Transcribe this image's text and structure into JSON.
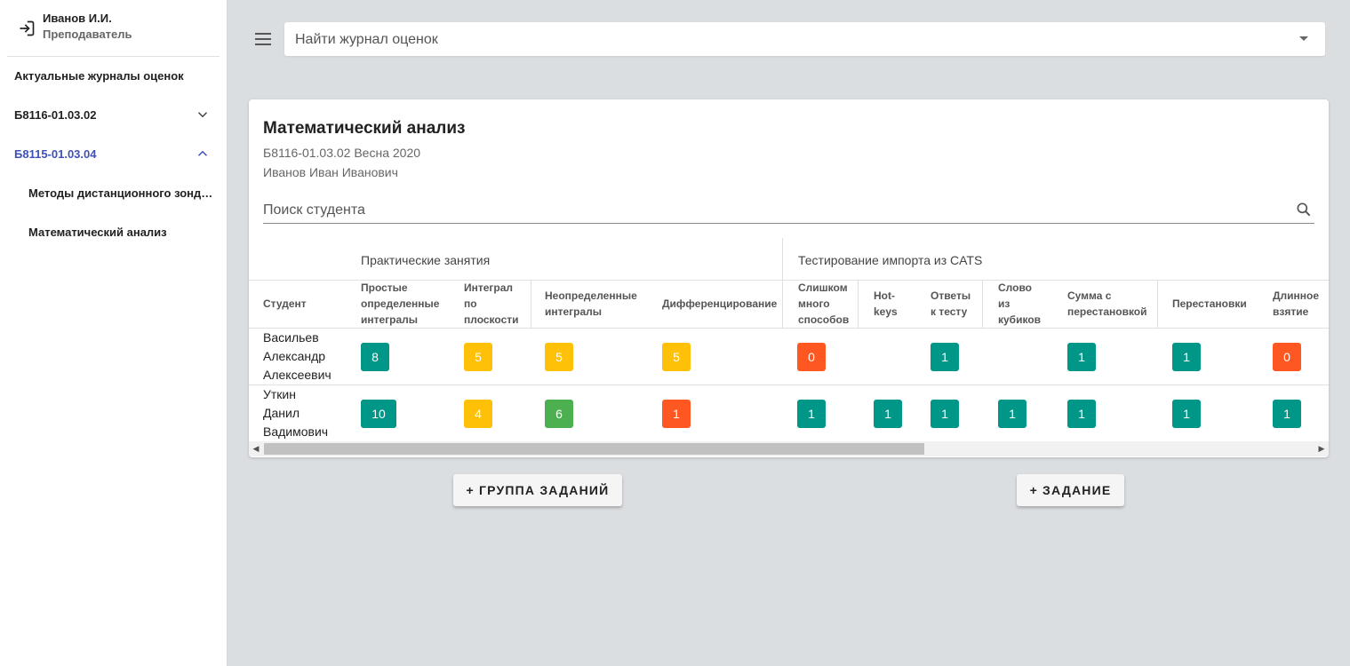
{
  "user": {
    "name": "Иванов И.И.",
    "role": "Преподаватель",
    "icon": "logout-icon"
  },
  "sidebar": {
    "section_title": "Актуальные журналы оценок",
    "groups": [
      {
        "label": "Б8116-01.03.02",
        "expanded": false
      },
      {
        "label": "Б8115-01.03.04",
        "expanded": true
      }
    ],
    "subitems": [
      "Методы дистанционного зондирования",
      "Математический анализ"
    ]
  },
  "topbar": {
    "search_placeholder": "Найти журнал оценок"
  },
  "card": {
    "title": "Математический анализ",
    "subtitle": "Б8116-01.03.02 Весна 2020",
    "teacher": "Иванов Иван Иванович",
    "student_search_placeholder": "Поиск студента"
  },
  "table": {
    "groups": [
      "Практические занятия",
      "Тестирование импорта из CATS"
    ],
    "headers": {
      "student": "Студент",
      "c1": [
        "Простые",
        "определенные",
        "интегралы"
      ],
      "c2": [
        "Интеграл",
        "по",
        "плоскости"
      ],
      "c3": [
        "Неопределенные",
        "интегралы"
      ],
      "c4": [
        "Дифференцирование"
      ],
      "c5": [
        "Слишком",
        "много",
        "способов"
      ],
      "c6": [
        "Hot-",
        "keys"
      ],
      "c7": [
        "Ответы",
        "к тесту"
      ],
      "c8": [
        "Слово",
        "из",
        "кубиков"
      ],
      "c9": [
        "Сумма с",
        "перестановкой"
      ],
      "c10": [
        "Перестановки"
      ],
      "c11": [
        "Длинное",
        "взятие"
      ]
    },
    "rows": [
      {
        "name": [
          "Васильев",
          "Александр",
          "Алексеевич"
        ],
        "grades": [
          "8",
          "5",
          "5",
          "5",
          "0",
          "",
          "1",
          "",
          "1",
          "1",
          "0"
        ],
        "colors": [
          "teal",
          "amber",
          "amber",
          "amber",
          "orange",
          "",
          "teal",
          "",
          "teal",
          "teal",
          "orange"
        ]
      },
      {
        "name": [
          "Уткин",
          "Данил",
          "Вадимович"
        ],
        "grades": [
          "10",
          "4",
          "6",
          "1",
          "1",
          "1",
          "1",
          "1",
          "1",
          "1",
          "1"
        ],
        "colors": [
          "teal",
          "amber",
          "green",
          "orange",
          "teal",
          "teal",
          "teal",
          "teal",
          "teal",
          "teal",
          "teal"
        ]
      }
    ]
  },
  "buttons": {
    "add_group": "+ ГРУППА ЗАДАНИЙ",
    "add_task": "+ ЗАДАНИЕ"
  },
  "colors": {
    "teal": "#009688",
    "amber": "#ffc107",
    "green": "#4caf50",
    "orange": "#ff5722",
    "accent": "#3f51b5"
  }
}
